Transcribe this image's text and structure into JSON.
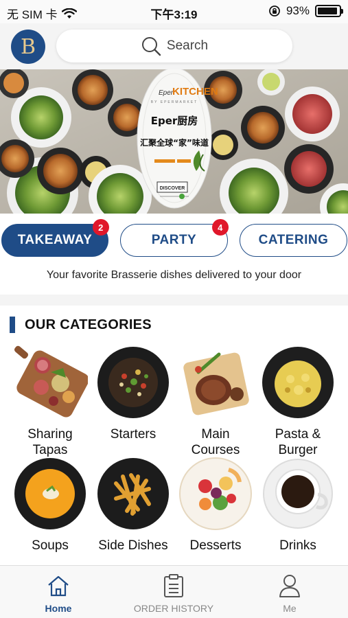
{
  "status_bar": {
    "carrier": "无 SIM 卡",
    "time": "下午3:19",
    "battery_percent": "93%",
    "battery_level": 0.93
  },
  "header": {
    "avatar_letter": "B",
    "search_placeholder": "Search"
  },
  "banner": {
    "brand_prefix": "Eper",
    "brand_name": "KITCHEN",
    "brand_sub": "BY EPERMARKET",
    "headline": "Eper厨房",
    "slogan": "汇聚全球“家”味道",
    "cta": "DISCOVER"
  },
  "services": [
    {
      "label": "TAKEAWAY",
      "badge": "2",
      "active": true
    },
    {
      "label": "PARTY",
      "badge": "4",
      "active": false
    },
    {
      "label": "CATERING",
      "badge": "",
      "active": false
    }
  ],
  "tagline": "Your favorite Brasserie dishes delivered to your door",
  "categories": {
    "title": "OUR CATEGORIES",
    "items": [
      {
        "line1": "Sharing",
        "line2": "Tapas"
      },
      {
        "line1": "Starters",
        "line2": ""
      },
      {
        "line1": "Main",
        "line2": "Courses"
      },
      {
        "line1": "Pasta &",
        "line2": "Burger"
      },
      {
        "line1": "Soups",
        "line2": ""
      },
      {
        "line1": "Side Dishes",
        "line2": ""
      },
      {
        "line1": "Desserts",
        "line2": ""
      },
      {
        "line1": "Drinks",
        "line2": ""
      }
    ]
  },
  "bottom_nav": [
    {
      "label": "Home",
      "icon": "home-icon",
      "active": true
    },
    {
      "label": "ORDER HISTORY",
      "icon": "clipboard-icon",
      "active": false
    },
    {
      "label": "Me",
      "icon": "user-icon",
      "active": false
    }
  ],
  "colors": {
    "brand_blue": "#1f4c87",
    "badge_red": "#e0172a",
    "avatar_gold": "#e8c98d"
  }
}
